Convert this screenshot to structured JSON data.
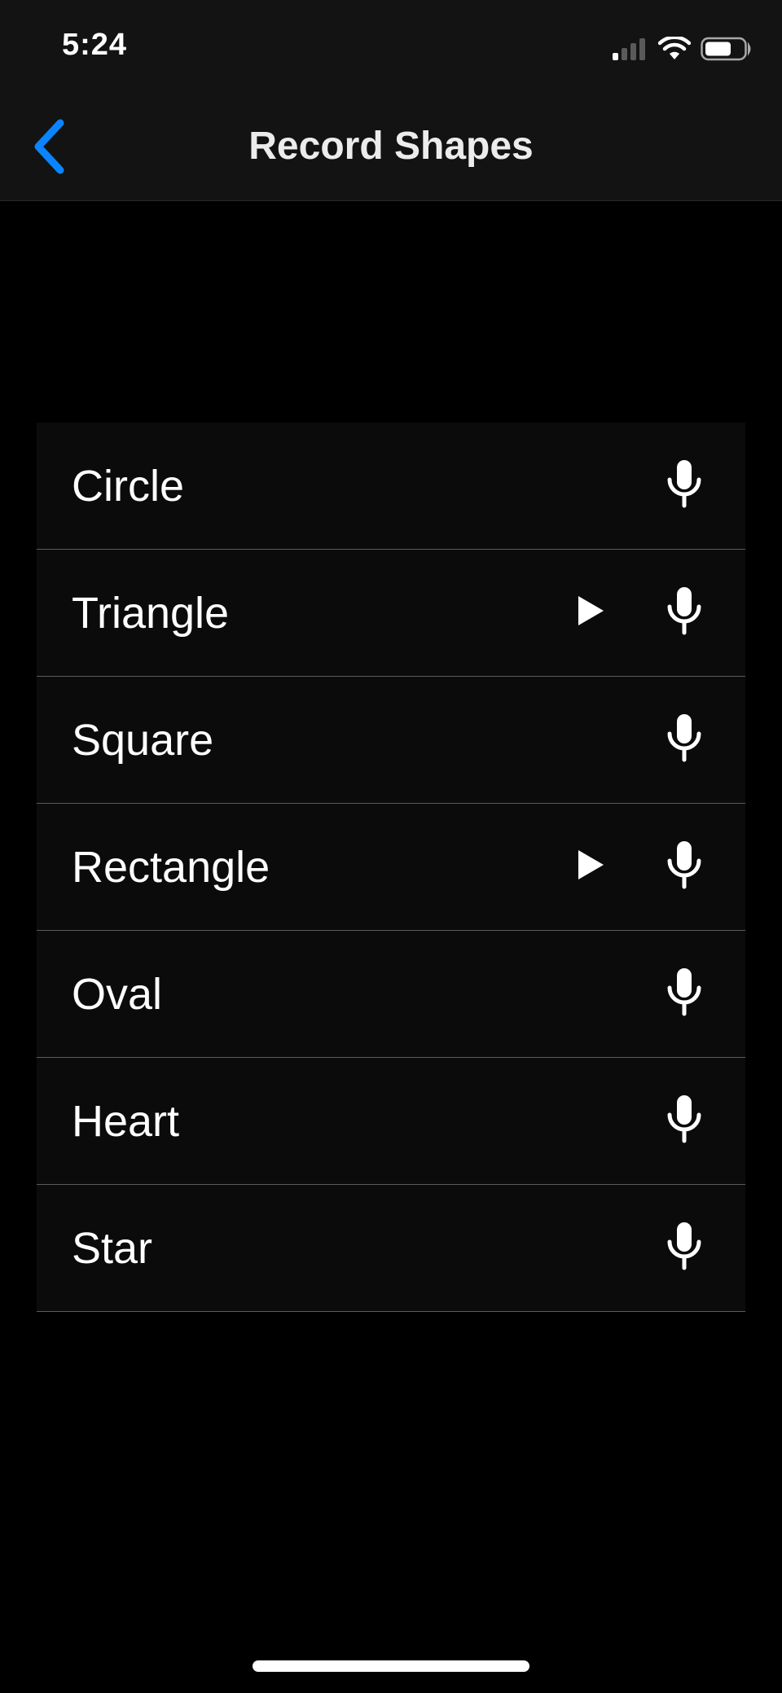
{
  "status_bar": {
    "time": "5:24",
    "icons": [
      "signal-icon",
      "wifi-icon",
      "battery-icon"
    ],
    "battery_level": 0.7
  },
  "nav": {
    "title": "Record Shapes",
    "back_icon": "chevron-left-icon",
    "accent_color": "#0a84ff"
  },
  "shapes": [
    {
      "label": "Circle",
      "has_recording": false
    },
    {
      "label": "Triangle",
      "has_recording": true
    },
    {
      "label": "Square",
      "has_recording": false
    },
    {
      "label": "Rectangle",
      "has_recording": true
    },
    {
      "label": "Oval",
      "has_recording": false
    },
    {
      "label": "Heart",
      "has_recording": false
    },
    {
      "label": "Star",
      "has_recording": false
    }
  ]
}
